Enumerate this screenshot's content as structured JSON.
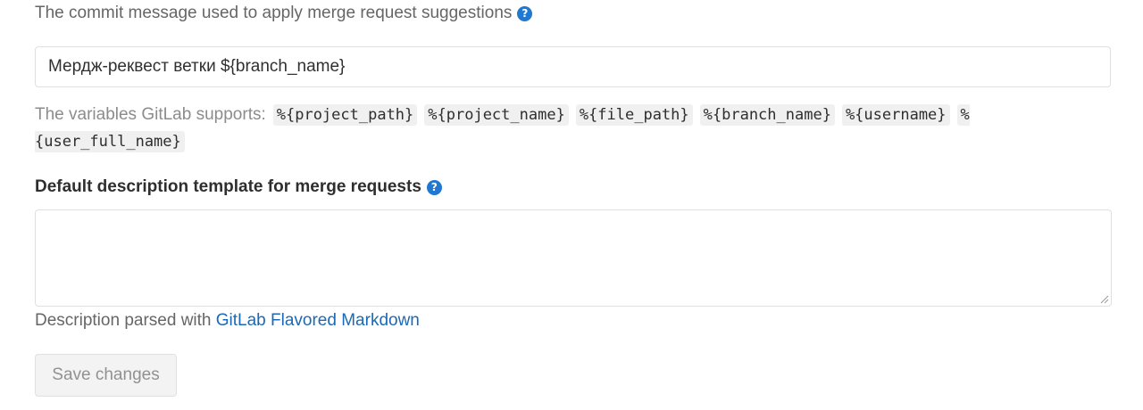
{
  "suggestions": {
    "help_text": "The commit message used to apply merge request suggestions",
    "help_icon": "question-circle-icon",
    "input_value": "Мердж-реквест ветки ${branch_name}"
  },
  "variables": {
    "label": "The variables GitLab supports:",
    "items": [
      "%{project_path}",
      "%{project_name}",
      "%{file_path}",
      "%{branch_name}",
      "%{username}",
      "%{user_full_name}"
    ]
  },
  "description_template": {
    "title": "Default description template for merge requests",
    "help_icon": "question-circle-icon",
    "value": "",
    "parsed_prefix": "Description parsed with",
    "parsed_link": "GitLab Flavored Markdown"
  },
  "actions": {
    "save_label": "Save changes"
  },
  "colors": {
    "link": "#1b69b6",
    "help_icon": "#1f78d1"
  }
}
